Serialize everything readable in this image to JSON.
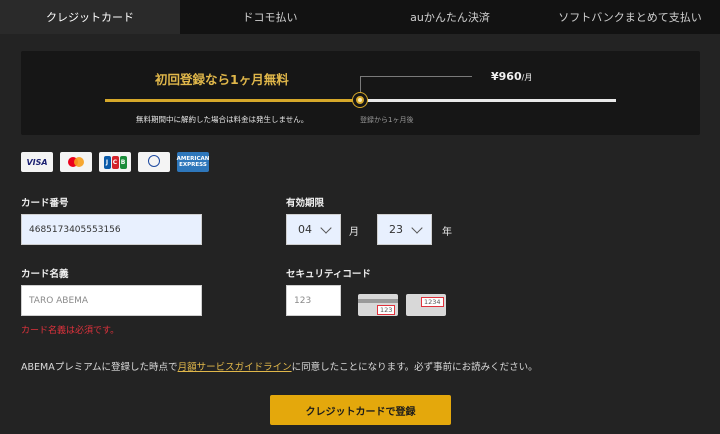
{
  "tabs": [
    "クレジットカード",
    "ドコモ払い",
    "auかんたん決済",
    "ソフトバンクまとめて支払い"
  ],
  "banner": {
    "headline": "初回登録なら1ヶ月無料",
    "price": "¥960",
    "price_unit": "/月",
    "note": "無料期間中に解約した場合は料金は発生しません。",
    "after": "登録から1ヶ月後"
  },
  "brands": {
    "visa": "VISA",
    "jcb": [
      "J",
      "C",
      "B"
    ],
    "amex": "AMERICAN EXPRESS"
  },
  "form": {
    "card_number_label": "カード番号",
    "card_number_value": "4685173405553156",
    "expiry_label": "有効期限",
    "month_value": "04",
    "month_unit": "月",
    "year_value": "23",
    "year_unit": "年",
    "card_name_label": "カード名義",
    "card_name_placeholder": "TARO ABEMA",
    "card_name_error": "カード名義は必須です。",
    "security_label": "セキュリティコード",
    "security_placeholder": "123",
    "cvv_sample_3": "123",
    "cvv_sample_4": "1234"
  },
  "terms": {
    "before": "ABEMAプレミアムに登録した時点で",
    "link": "月額サービスガイドライン",
    "after": "に同意したことになります。必ず事前にお読みください。"
  },
  "submit_label": "クレジットカードで登録",
  "colors": {
    "accent": "#e4a80c",
    "gold_text": "#e0b74a",
    "error": "#e0323c"
  }
}
